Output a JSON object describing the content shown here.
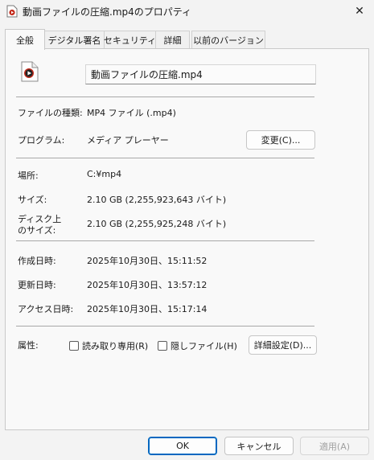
{
  "window": {
    "title": "動画ファイルの圧縮.mp4のプロパティ",
    "title_icon": "media-file-icon",
    "close_glyph": "✕"
  },
  "tabs": [
    {
      "label": "全般",
      "active": true
    },
    {
      "label": "デジタル署名",
      "active": false
    },
    {
      "label": "セキュリティ",
      "active": false
    },
    {
      "label": "詳細",
      "active": false
    },
    {
      "label": "以前のバージョン",
      "active": false
    }
  ],
  "general": {
    "file_icon": "media-file-icon",
    "file_name": "動画ファイルの圧縮.mp4",
    "file_type_label": "ファイルの種類:",
    "file_type_value": "MP4 ファイル (.mp4)",
    "program_label": "プログラム:",
    "program_value": "メディア プレーヤー",
    "change_button": "変更(C)...",
    "location_label": "場所:",
    "location_value": "C:¥mp4",
    "size_label": "サイズ:",
    "size_value": "2.10 GB (2,255,923,643 バイト)",
    "disk_size_label_line1": "ディスク上",
    "disk_size_label_line2": "のサイズ:",
    "disk_size_value": "2.10 GB (2,255,925,248 バイト)",
    "created_label": "作成日時:",
    "created_value": "2025年10月30日、15:11:52",
    "modified_label": "更新日時:",
    "modified_value": "2025年10月30日、13:57:12",
    "accessed_label": "アクセス日時:",
    "accessed_value": "2025年10月30日、15:17:14",
    "attributes_label": "属性:",
    "readonly_label": "読み取り専用(R)",
    "readonly_checked": false,
    "hidden_label": "隠しファイル(H)",
    "hidden_checked": false,
    "advanced_button": "詳細設定(D)..."
  },
  "footer": {
    "ok": "OK",
    "cancel": "キャンセル",
    "apply": "適用(A)",
    "apply_enabled": false
  },
  "colors": {
    "accent": "#0067c0",
    "icon_red": "#c42b1c",
    "disabled_text": "#a0a0a0"
  }
}
